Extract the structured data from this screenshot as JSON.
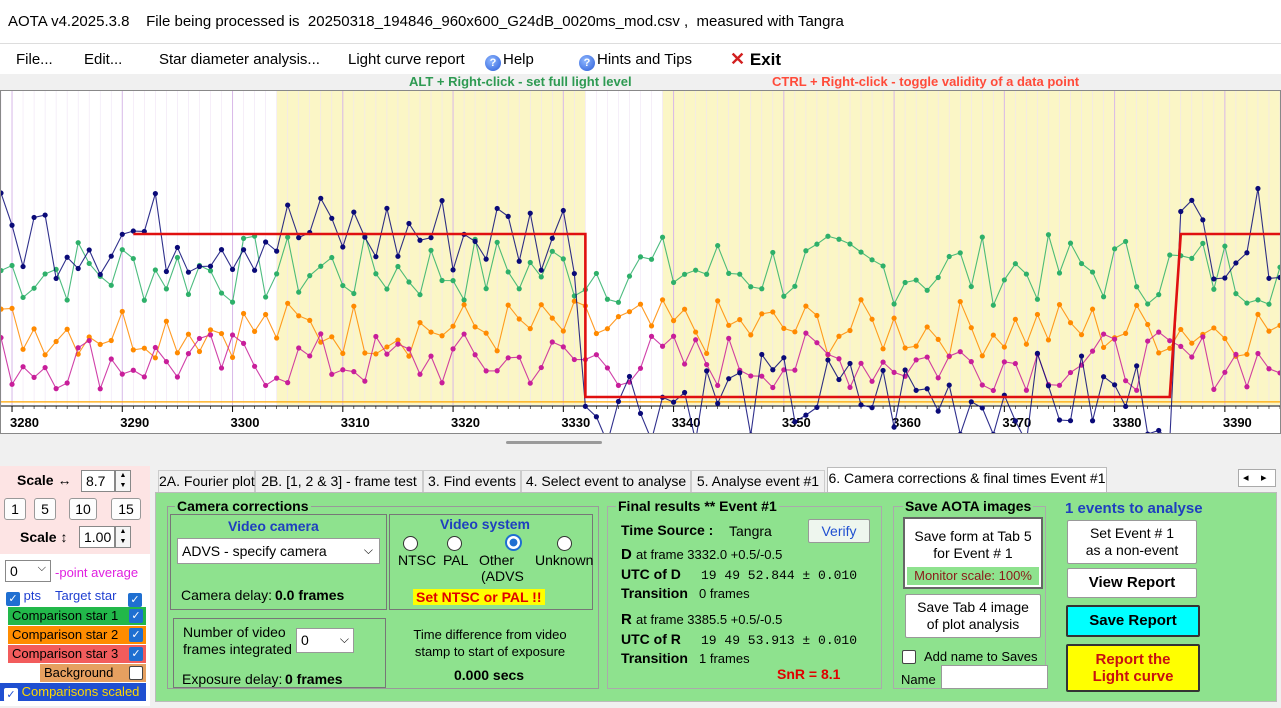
{
  "window": {
    "title": "AOTA v4.2025.3.8    File being processed is  20250318_194846_960x600_G24dB_0020ms_mod.csv ,  measured with Tangra"
  },
  "menu": {
    "file": "File...",
    "edit": "Edit...",
    "star_diameter": "Star diameter analysis...",
    "light_curve_report": "Light curve report",
    "help": "Help",
    "hints": "Hints and Tips",
    "exit": "Exit",
    "help_icon": "?",
    "exit_icon": "✕"
  },
  "hints": {
    "alt_right_click": "ALT + Right-click  -  set full light level",
    "ctrl_right_click": "CTRL + Right-click  -  toggle validity of a data point",
    "alt_color": "#2e9a52",
    "ctrl_color": "#ff4b3a"
  },
  "chart_data": {
    "type": "line",
    "x_ticks": [
      "3280",
      "3290",
      "3300",
      "3310",
      "3320",
      "3330",
      "3340",
      "3350",
      "3360",
      "3370",
      "3380",
      "3390"
    ],
    "xlim": [
      3279,
      3395
    ],
    "full_level": 1.0,
    "event_level": 0.0,
    "D_frame": 3332.0,
    "R_frame": 3385.5,
    "highlight_regions": [
      [
        3304,
        3332
      ],
      [
        3339,
        3395
      ]
    ],
    "series": [
      {
        "name": "Target star",
        "color": "#0a0a78"
      },
      {
        "name": "Comparison star 1",
        "color": "#2eb06a"
      },
      {
        "name": "Comparison star 2",
        "color": "#ff8a00"
      },
      {
        "name": "Comparison star 3",
        "color": "#c81e9a"
      }
    ],
    "model_color": "#e01010",
    "baseline_color": "#ffa500"
  },
  "left_panel": {
    "scale_h_label": "Scale ↔",
    "scale_h_value": "8.7",
    "preset_buttons": [
      "1",
      "5",
      "10",
      "15"
    ],
    "scale_v_label": "Scale ↕",
    "scale_v_value": "1.00",
    "point_average_value": "0",
    "point_average_label": "point average",
    "pts_label": "pts",
    "target_star": "Target star",
    "comparison_1": "Comparison star 1",
    "comparison_2": "Comparison star 2",
    "comparison_3": "Comparison star 3",
    "background": "Background",
    "comparisons_scaled": "Comparisons scaled",
    "check_icon": "✓",
    "colors": {
      "comp1": "#22b84a",
      "comp2": "#ff8c00",
      "comp3": "#f25c5c",
      "bg": "#e6a060",
      "scaled": "#1f4fd1"
    }
  },
  "tabs": [
    "2A. Fourier plot",
    "2B. [1, 2 & 3] - frame test",
    "3. Find events",
    "4. Select event to analyse",
    "5. Analyse event #1",
    "6. Camera corrections & final times Event #1"
  ],
  "tab_nav": {
    "left": "◂",
    "right": "▸"
  },
  "camera_corrections": {
    "title": "Camera corrections",
    "video_camera_title": "Video camera",
    "camera_select": "ADVS - specify camera",
    "camera_delay_label": "Camera delay:",
    "camera_delay_value": "0.0 frames",
    "video_system_title": "Video system",
    "ntsc": "NTSC",
    "pal": "PAL",
    "other": "Other",
    "other_sub": "(ADVS",
    "unknown": "Unknown",
    "warning": "Set NTSC or PAL !!",
    "frames_integrated_label": "Number of video frames integrated",
    "frames_integrated_value": "0",
    "exposure_delay_label": "Exposure delay:",
    "exposure_delay_value": "0 frames",
    "time_diff_label": "Time difference from video stamp to start of exposure",
    "time_diff_value": "0.000 secs"
  },
  "final_results": {
    "title": "Final results  **  Event #1",
    "time_source_label": "Time Source :",
    "time_source_value": "Tangra",
    "verify": "Verify",
    "d_label": "D",
    "d_frame": "at frame 3332.0  +0.5/-0.5",
    "utc_d_label": "UTC of D",
    "utc_d_value": "19 49 52.844 ± 0.010",
    "transition_label": "Transition",
    "d_transition": "0 frames",
    "r_label": "R",
    "r_frame": "at frame 3385.5  +0.5/-0.5",
    "utc_r_label": "UTC of R",
    "utc_r_value": "19 49 53.913 ± 0.010",
    "r_transition": "1 frames",
    "snr": "SnR = 8.1"
  },
  "save_images": {
    "title": "Save AOTA images",
    "save_form": "Save form at Tab 5\nfor Event # 1",
    "monitor_scale": "Monitor scale: 100%",
    "save_tab4": "Save Tab 4 image\nof plot analysis",
    "add_name": "Add name to Saves",
    "name_label": "Name",
    "name_value": ""
  },
  "report": {
    "events_label": "1 events to analyse",
    "set_non_event": "Set Event # 1\nas a non-event",
    "view_report": "View Report",
    "save_report": "Save Report",
    "report_light_curve": "Report the\nLight curve"
  }
}
